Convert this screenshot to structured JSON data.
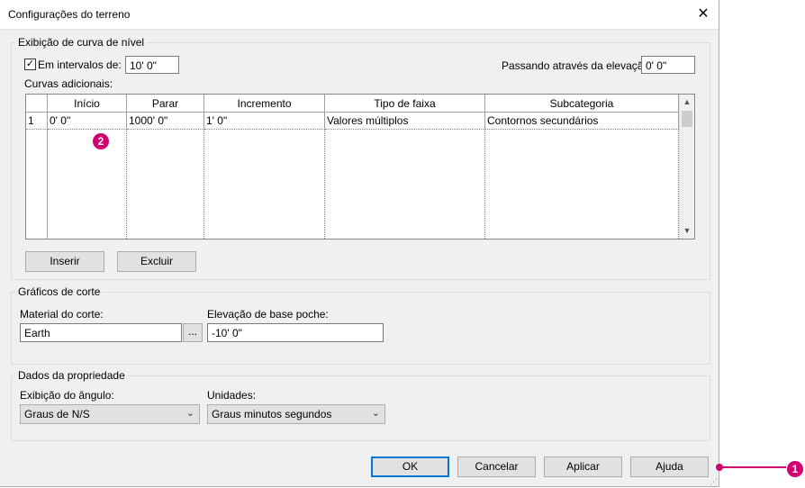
{
  "window": {
    "title": "Configurações do terreno"
  },
  "contour": {
    "legend": "Exibição de curva de nível",
    "interval_checkbox_checked": true,
    "interval_label": "Em intervalos de:",
    "interval_value": "10'  0\"",
    "passing_label": "Passando através da elevação:",
    "passing_value": "0'  0\"",
    "additional_label": "Curvas adicionais:",
    "columns": [
      "Início",
      "Parar",
      "Incremento",
      "Tipo de faixa",
      "Subcategoria"
    ],
    "rows": [
      {
        "num": "1",
        "start": "0'  0\"",
        "stop": "1000'  0\"",
        "increment": "1'  0\"",
        "range_type": "Valores múltiplos",
        "subcategory": "Contornos secundários"
      }
    ],
    "insert_label": "Inserir",
    "delete_label": "Excluir"
  },
  "section": {
    "legend": "Gráficos de corte",
    "material_label": "Material do corte:",
    "material_value": "Earth",
    "browse_label": "...",
    "elevation_label": "Elevação de base poche:",
    "elevation_value": "-10'  0\""
  },
  "property": {
    "legend": "Dados da propriedade",
    "angle_label": "Exibição do ângulo:",
    "angle_value": "Graus de N/S",
    "units_label": "Unidades:",
    "units_value": "Graus minutos segundos"
  },
  "buttons": {
    "ok": "OK",
    "cancel": "Cancelar",
    "apply": "Aplicar",
    "help": "Ajuda"
  },
  "callouts": {
    "one": "1",
    "two": "2"
  },
  "colors": {
    "callout": "#d0006f",
    "default_button_border": "#0078d7"
  }
}
